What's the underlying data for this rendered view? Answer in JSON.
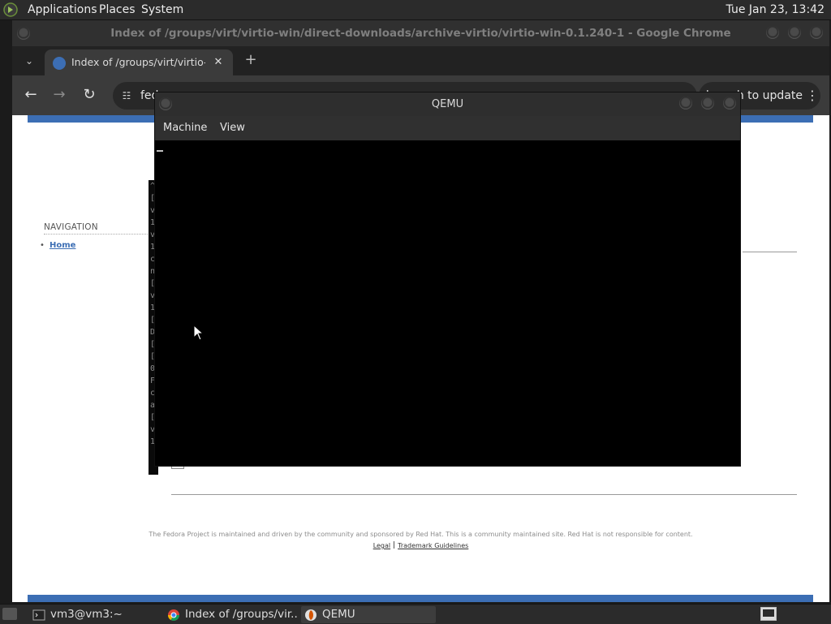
{
  "top_panel": {
    "menus": [
      "Applications",
      "Places",
      "System"
    ],
    "clock": "Tue Jan 23, 13:42"
  },
  "chrome": {
    "window_title": "Index of /groups/virt/virtio-win/direct-downloads/archive-virtio/virtio-win-0.1.240-1 - Google Chrome",
    "tab_title": "Index of /groups/virt/virtio-w",
    "tab_close_glyph": "✕",
    "new_tab_glyph": "+",
    "url_visible": "fed",
    "update_button": "Relaunch to update",
    "menu_glyph": "⋮"
  },
  "page": {
    "navigation_heading": "NAVIGATION",
    "nav_items": [
      "Home"
    ],
    "footer_text": "The Fedora Project is maintained and driven by the community and sponsored by Red Hat. This is a community maintained site. Red Hat is not responsible for content.",
    "footer_links": [
      "Legal",
      "Trademark Guidelines"
    ],
    "terminal_peek_chars": [
      "^",
      "[",
      "v",
      "1",
      "v",
      "1",
      "c",
      "n",
      "[",
      "v",
      "1",
      "[",
      "D",
      "[",
      "[",
      "0",
      "F",
      "c",
      "a",
      "[",
      "v",
      "1"
    ]
  },
  "qemu": {
    "title": "QEMU",
    "menu": [
      "Machine",
      "View"
    ]
  },
  "taskbar": {
    "tasks": [
      {
        "label": "vm3@vm3:~",
        "icon": "terminal-icon",
        "active": false
      },
      {
        "label": "Index of /groups/vir...",
        "icon": "chrome-icon",
        "active": false
      },
      {
        "label": "QEMU",
        "icon": "qemu-icon",
        "active": true
      }
    ]
  },
  "colors": {
    "fedora_blue": "#3c6eb4",
    "panel_bg": "#2b2b2b",
    "chrome_toolbar": "#3b3b3b"
  }
}
